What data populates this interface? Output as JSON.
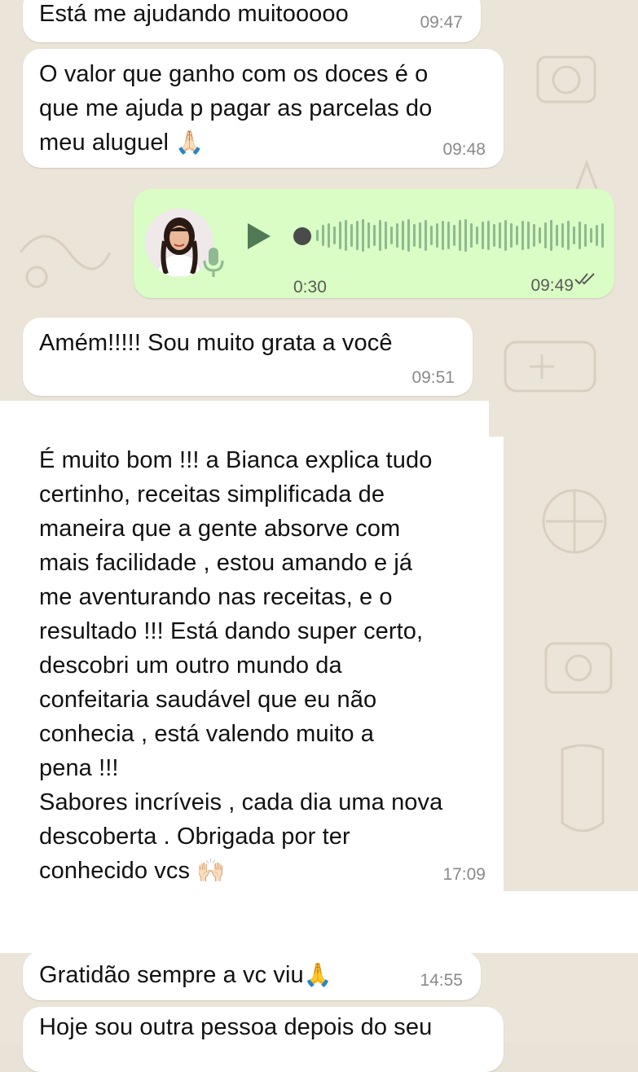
{
  "chat": {
    "messages": [
      {
        "text": "Está me ajudando muitooooo",
        "time": "09:47"
      },
      {
        "text": "O valor que ganho com os doces é o\nque me ajuda p pagar as parcelas do\nmeu aluguel",
        "emoji": "🙏🏻",
        "time": "09:48"
      },
      {
        "duration": "0:30",
        "time": "09:49"
      },
      {
        "text": "Amém!!!!! Sou muito grata a você",
        "time": "09:51"
      },
      {
        "text": "É muito bom !!! a Bianca explica tudo\ncertinho, receitas simplificada de\nmaneira que a gente absorve com\nmais facilidade , estou amando e já\nme aventurando nas receitas, e o\nresultado !!! Está dando super certo,\ndescobri um outro mundo da\nconfeitaria saudável que eu não\nconhecia , está valendo muito a\npena !!!\nSabores incríveis , cada dia uma nova\ndescoberta . Obrigada por ter\nconhecido vcs",
        "emoji": "🙌🏻",
        "time": "17:09"
      },
      {
        "text": "Gratidão sempre a vc viu",
        "emoji": "🙏",
        "time": "14:55"
      },
      {
        "text": "Hoje sou outra pessoa depois do seu"
      }
    ]
  },
  "colors": {
    "wallpaper": "#ebe4d8",
    "incoming_bubble": "#ffffff",
    "outgoing_bubble": "#d9fdc4",
    "waveform": "#8fb991",
    "read_ticks": "#5a5a5a"
  },
  "icons": [
    "play-icon",
    "microphone-icon",
    "double-check-icon",
    "avatar"
  ]
}
